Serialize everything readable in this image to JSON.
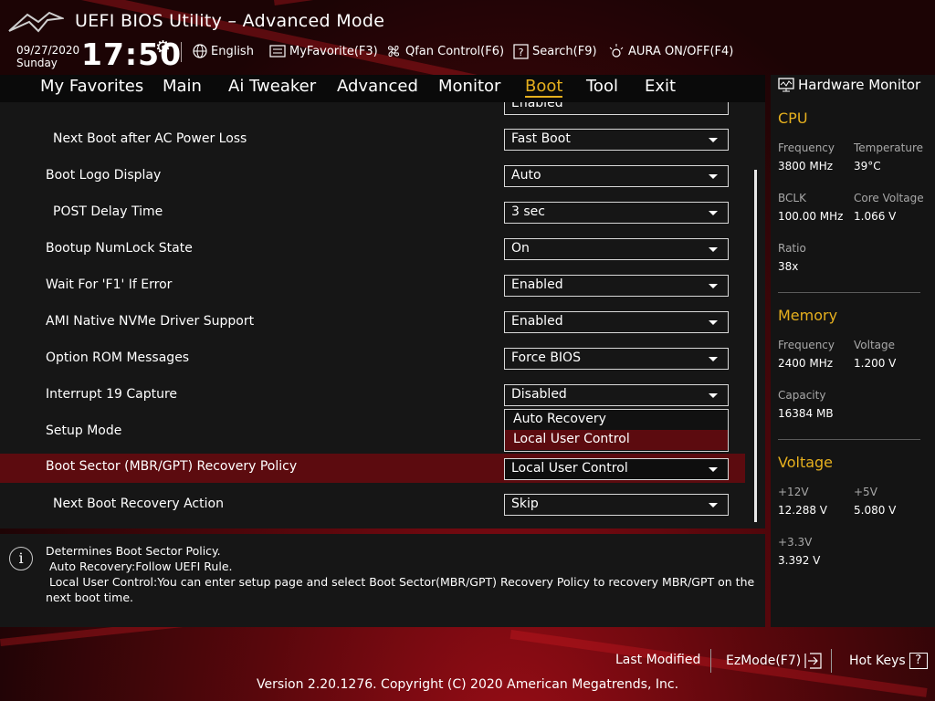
{
  "header": {
    "title": "UEFI BIOS Utility – Advanced Mode",
    "date": "09/27/2020",
    "day": "Sunday",
    "time": "17:50",
    "buttons": {
      "language": "English",
      "my_favorite": "MyFavorite(F3)",
      "qfan": "Qfan Control(F6)",
      "search": "Search(F9)",
      "aura": "AURA ON/OFF(F4)"
    }
  },
  "nav": {
    "tabs": [
      "My Favorites",
      "Main",
      "Ai Tweaker",
      "Advanced",
      "Monitor",
      "Boot",
      "Tool",
      "Exit"
    ],
    "active": "Boot"
  },
  "settings": [
    {
      "label": "",
      "value": "Enabled"
    },
    {
      "label": "Next Boot after AC Power Loss",
      "value": "Fast Boot"
    },
    {
      "label": "Boot Logo Display",
      "value": "Auto"
    },
    {
      "label": "POST Delay Time",
      "value": "3 sec"
    },
    {
      "label": "Bootup NumLock State",
      "value": "On"
    },
    {
      "label": "Wait For 'F1' If Error",
      "value": "Enabled"
    },
    {
      "label": "AMI Native NVMe Driver Support",
      "value": "Enabled"
    },
    {
      "label": "Option ROM Messages",
      "value": "Force BIOS"
    },
    {
      "label": "Interrupt 19 Capture",
      "value": "Disabled"
    },
    {
      "label": "Setup Mode",
      "value": ""
    },
    {
      "label": "Boot Sector (MBR/GPT) Recovery Policy",
      "value": "Local User Control"
    },
    {
      "label": "Next Boot Recovery Action",
      "value": "Skip"
    }
  ],
  "dropdown_popup": {
    "options": [
      "Auto Recovery",
      "Local User Control"
    ],
    "highlighted": "Local User Control"
  },
  "help": {
    "lines": [
      "Determines Boot Sector Policy.",
      " Auto Recovery:Follow UEFI Rule.",
      " Local User Control:You can enter setup page and select Boot Sector(MBR/GPT) Recovery Policy to recovery MBR/GPT on the next boot time."
    ]
  },
  "hardware_monitor": {
    "title": "Hardware Monitor",
    "cpu": {
      "heading": "CPU",
      "frequency_label": "Frequency",
      "frequency": "3800 MHz",
      "temperature_label": "Temperature",
      "temperature": "39°C",
      "bclk_label": "BCLK",
      "bclk": "100.00 MHz",
      "core_voltage_label": "Core Voltage",
      "core_voltage": "1.066 V",
      "ratio_label": "Ratio",
      "ratio": "38x"
    },
    "memory": {
      "heading": "Memory",
      "frequency_label": "Frequency",
      "frequency": "2400 MHz",
      "voltage_label": "Voltage",
      "voltage": "1.200 V",
      "capacity_label": "Capacity",
      "capacity": "16384 MB"
    },
    "voltage": {
      "heading": "Voltage",
      "v12_label": "+12V",
      "v12": "12.288 V",
      "v5_label": "+5V",
      "v5": "5.080 V",
      "v33_label": "+3.3V",
      "v33": "3.392 V"
    }
  },
  "footer": {
    "last_modified": "Last Modified",
    "ezmode": "EzMode(F7)",
    "hotkeys": "Hot Keys",
    "hotkeys_key": "?",
    "copyright": "Version 2.20.1276. Copyright (C) 2020 American Megatrends, Inc."
  },
  "colors": {
    "accent": "#e6b01e",
    "selection": "#5c0b0f",
    "panel": "#161616",
    "brand_red": "#9a0d16"
  }
}
